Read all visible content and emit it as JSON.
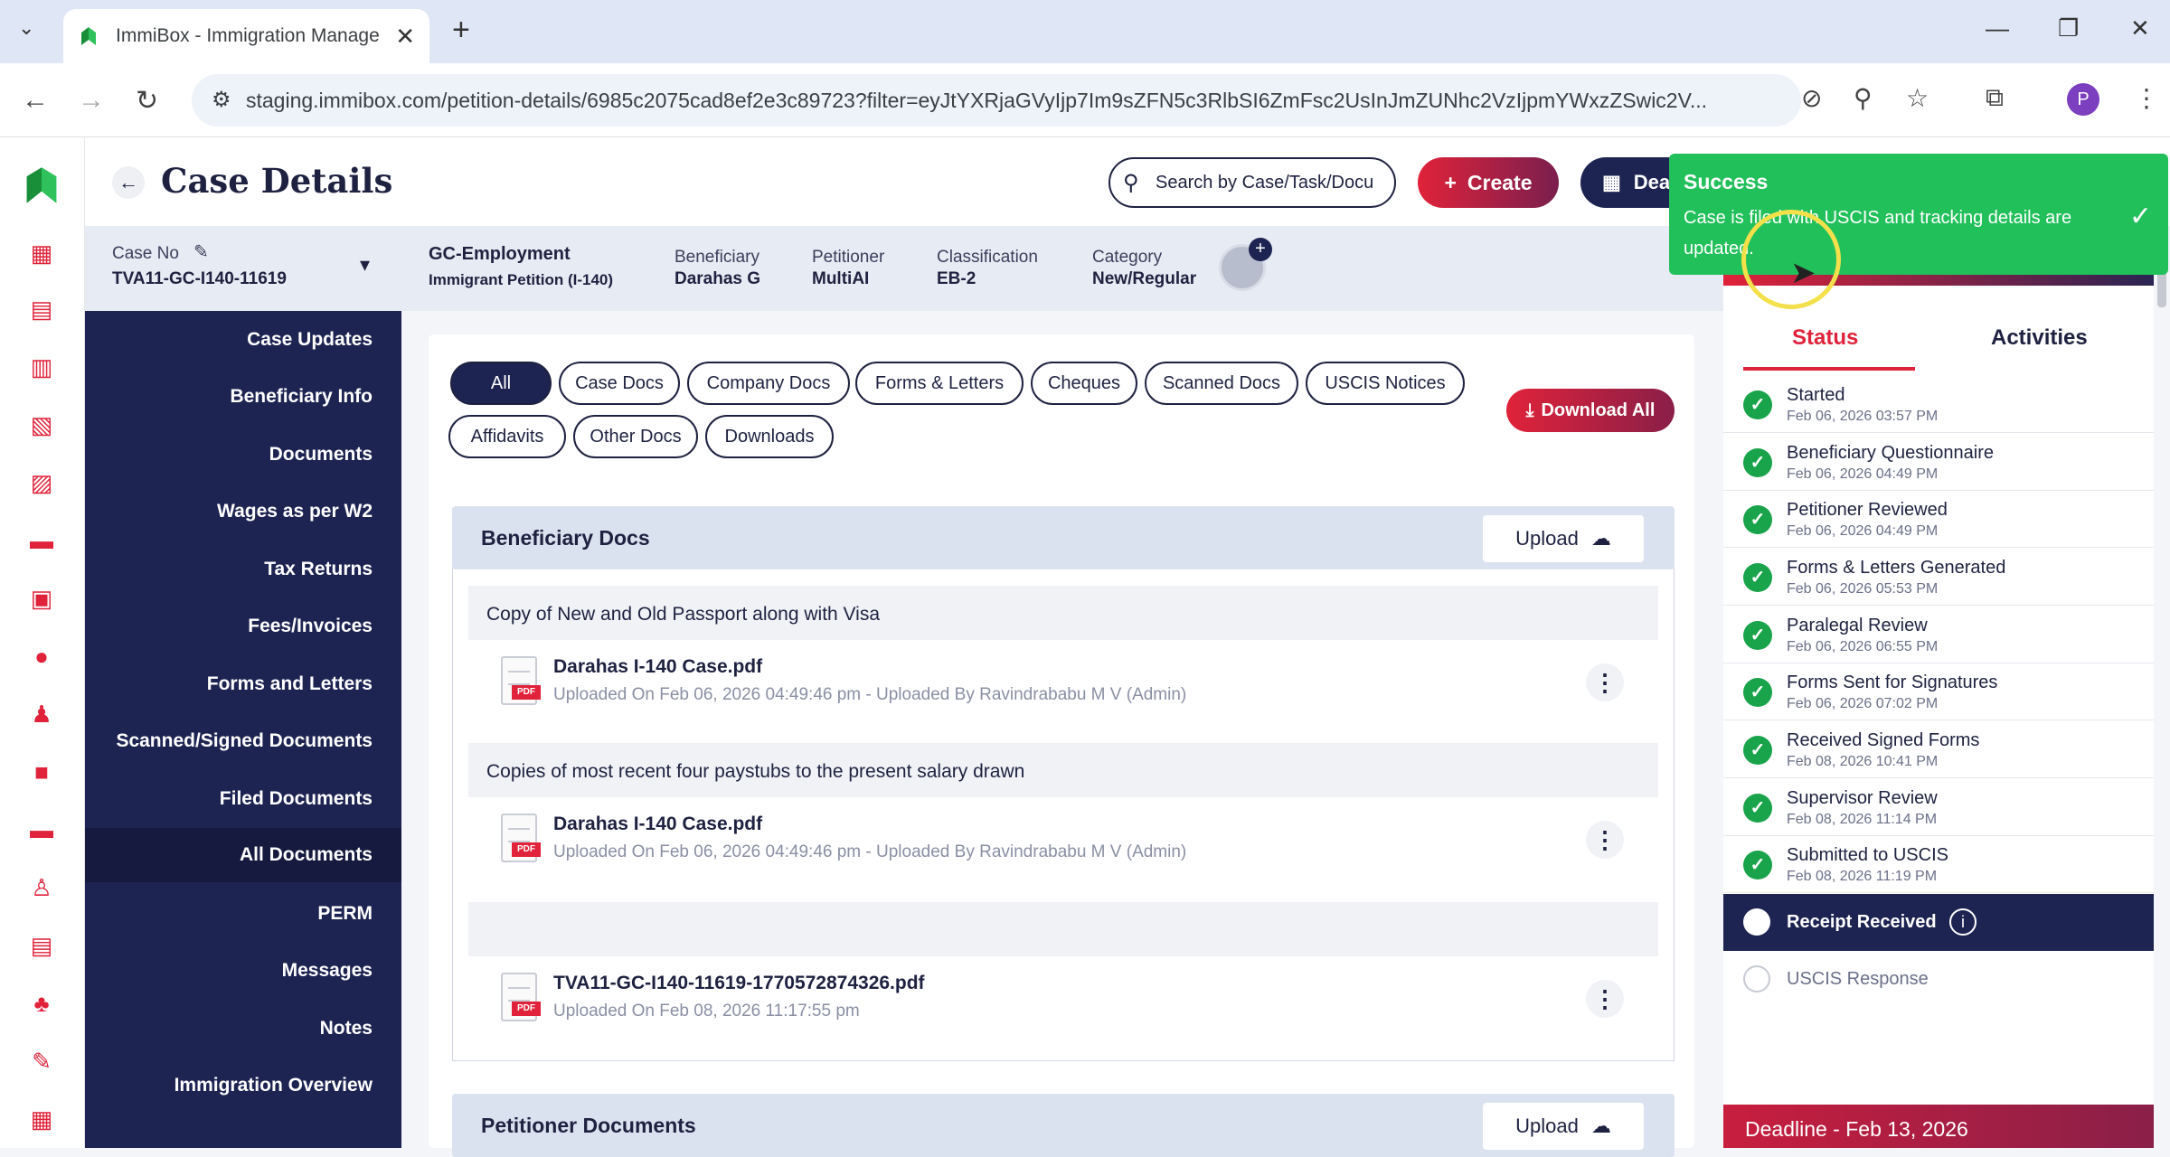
{
  "browser": {
    "tab_title": "ImmiBox - Immigration Manage",
    "url": "staging.immibox.com/petition-details/6985c2075cad8ef2e3c89723?filter=eyJtYXRjaGVyIjp7Im9sZFN5c3RlbSI6ZmFsc2UsInJmZUNhc2VzIjpmYWxzZSwic2V...",
    "profile_initial": "P"
  },
  "header": {
    "title": "Case Details",
    "search_placeholder": "Search by Case/Task/Docu",
    "create_label": "Create",
    "deadline_btn_label": "Dea"
  },
  "case": {
    "case_no_label": "Case No",
    "case_no": "TVA11-GC-I140-11619",
    "type": "GC-Employment",
    "subtype": "Immigrant Petition (I-140)",
    "fields": [
      {
        "label": "Beneficiary",
        "value": "Darahas G"
      },
      {
        "label": "Petitioner",
        "value": "MultiAI"
      },
      {
        "label": "Classification",
        "value": "EB-2"
      },
      {
        "label": "Category",
        "value": "New/Regular"
      }
    ]
  },
  "sidenav": {
    "items": [
      "Case Updates",
      "Beneficiary Info",
      "Documents",
      "Wages as per W2",
      "Tax Returns",
      "Fees/Invoices",
      "Forms and Letters",
      "Scanned/Signed Documents",
      "Filed Documents",
      "All Documents",
      "PERM",
      "Messages",
      "Notes",
      "Immigration Overview"
    ],
    "active": "All Documents"
  },
  "filters": {
    "row1": [
      "All",
      "Case Docs",
      "Company Docs",
      "Forms & Letters",
      "Cheques",
      "Scanned Docs",
      "USCIS Notices"
    ],
    "row2": [
      "Affidavits",
      "Other Docs",
      "Downloads"
    ],
    "download_all": "Download All"
  },
  "sections": {
    "beneficiary": {
      "name": "Beneficiary Docs",
      "upload": "Upload",
      "groups": [
        {
          "title": "Copy of New and Old Passport along with Visa",
          "file": "Darahas I-140 Case.pdf",
          "meta": "Uploaded On Feb 06, 2026 04:49:46 pm - Uploaded By Ravindrababu M V (Admin)"
        },
        {
          "title": "Copies of most recent four paystubs to the present salary drawn",
          "file": "Darahas I-140 Case.pdf",
          "meta": "Uploaded On Feb 06, 2026 04:49:46 pm - Uploaded By Ravindrababu M V (Admin)"
        },
        {
          "title": "",
          "file": "TVA11-GC-I140-11619-1770572874326.pdf",
          "meta": "Uploaded On Feb 08, 2026 11:17:55 pm"
        }
      ]
    },
    "petitioner": {
      "name": "Petitioner Documents",
      "upload": "Upload"
    }
  },
  "pdf_tag": "PDF",
  "status_panel": {
    "tabs": [
      "Status",
      "Activities"
    ],
    "steps": [
      {
        "name": "Started",
        "date": "Feb 06, 2026 03:57 PM"
      },
      {
        "name": "Beneficiary Questionnaire",
        "date": "Feb 06, 2026 04:49 PM"
      },
      {
        "name": "Petitioner Reviewed",
        "date": "Feb 06, 2026 04:49 PM"
      },
      {
        "name": "Forms & Letters Generated",
        "date": "Feb 06, 2026 05:53 PM"
      },
      {
        "name": "Paralegal Review",
        "date": "Feb 06, 2026 06:55 PM"
      },
      {
        "name": "Forms Sent for Signatures",
        "date": "Feb 06, 2026 07:02 PM"
      },
      {
        "name": "Received Signed Forms",
        "date": "Feb 08, 2026 10:41 PM"
      },
      {
        "name": "Supervisor Review",
        "date": "Feb 08, 2026 11:14 PM"
      },
      {
        "name": "Submitted to USCIS",
        "date": "Feb 08, 2026 11:19 PM"
      }
    ],
    "current_step": "Receipt Received",
    "pending_step": "USCIS Response",
    "deadline": "Deadline - Feb 13, 2026"
  },
  "toast": {
    "title": "Success",
    "message": "Case is filed with USCIS and tracking details are updated."
  },
  "colors": {
    "brand_red": "#e0223a",
    "navy": "#1e2452",
    "success": "#22c05b"
  }
}
